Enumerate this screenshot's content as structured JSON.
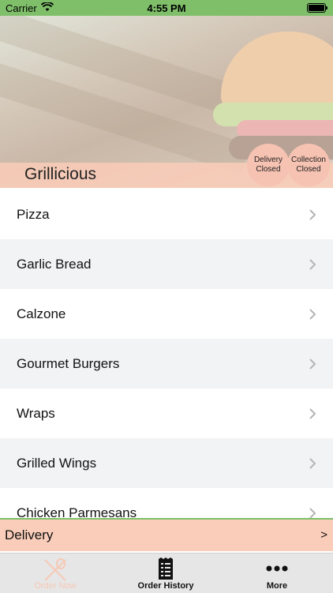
{
  "status_bar": {
    "carrier": "Carrier",
    "time": "4:55 PM"
  },
  "restaurant": {
    "name": "Grillicious",
    "delivery_status": {
      "line1": "Delivery",
      "line2": "Closed"
    },
    "collection_status": {
      "line1": "Collection",
      "line2": "Closed"
    }
  },
  "menu": {
    "items": [
      {
        "label": "Pizza"
      },
      {
        "label": "Garlic Bread"
      },
      {
        "label": "Calzone"
      },
      {
        "label": "Gourmet Burgers"
      },
      {
        "label": "Wraps"
      },
      {
        "label": "Grilled Wings"
      },
      {
        "label": "Chicken Parmesans"
      }
    ]
  },
  "order_mode": {
    "label": "Delivery",
    "arrow": ">"
  },
  "tabs": [
    {
      "label": "Order Now",
      "icon": "utensils-icon",
      "active": true
    },
    {
      "label": "Order History",
      "icon": "receipt-icon"
    },
    {
      "label": "More",
      "icon": "more-dots-icon"
    }
  ],
  "colors": {
    "accent_green": "#7fbf6a",
    "peach": "#f9cdb9",
    "circle": "#f6c2b2"
  }
}
